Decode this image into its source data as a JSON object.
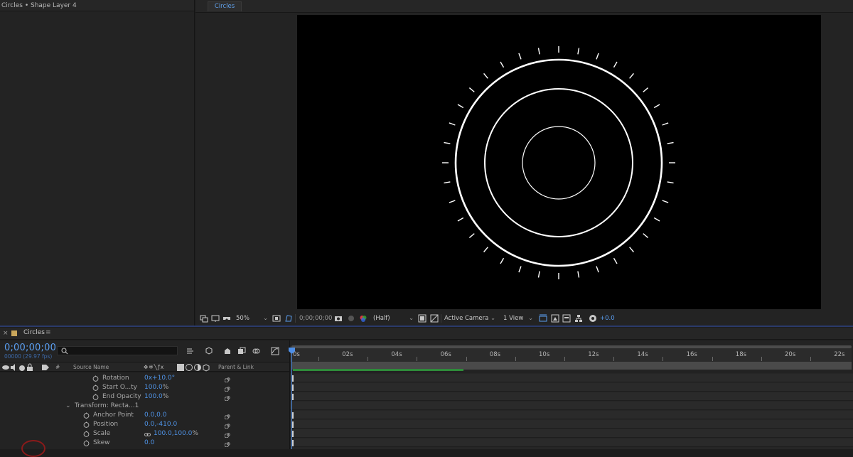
{
  "left_panel": {
    "title": "Circles • Shape Layer 4"
  },
  "viewer": {
    "tab": "Circles",
    "toolbar": {
      "zoom": "50%",
      "timecode": "0;00;00;00",
      "resolution": "(Half)",
      "camera": "Active Camera",
      "views": "1 View",
      "exposure": "+0.0"
    }
  },
  "timeline": {
    "close": "×",
    "tab_title": "Circles",
    "menu_icon": "≡",
    "timecode": "0;00;00;00",
    "fps": "00000 (29.97 fps)",
    "search_placeholder": "",
    "column_headers": {
      "hash": "#",
      "source_name": "Source Name",
      "parent": "Parent & Link"
    },
    "ruler_labels": [
      "0s",
      "02s",
      "04s",
      "06s",
      "08s",
      "10s",
      "12s",
      "14s",
      "16s",
      "18s",
      "20s",
      "22s"
    ],
    "properties": [
      {
        "name": "Rotation",
        "value": "0x+10.0°"
      },
      {
        "name": "Start O...ty",
        "value": "100.0",
        "unit": "%"
      },
      {
        "name": "End Opacity",
        "value": "100.0",
        "unit": "%"
      },
      {
        "name": "Transform: Recta...1",
        "group": true
      },
      {
        "name": "Anchor Point",
        "value": "0.0,0.0"
      },
      {
        "name": "Position",
        "value": "0.0,-410.0"
      },
      {
        "name": "Scale",
        "value": "100.0,100.0",
        "unit": "%"
      },
      {
        "name": "Skew",
        "value": "0.0"
      }
    ]
  },
  "colors": {
    "accent_blue": "#4f93e6",
    "canvas": "#000000",
    "panel": "#232323",
    "green_bar": "#2e8b3a"
  }
}
